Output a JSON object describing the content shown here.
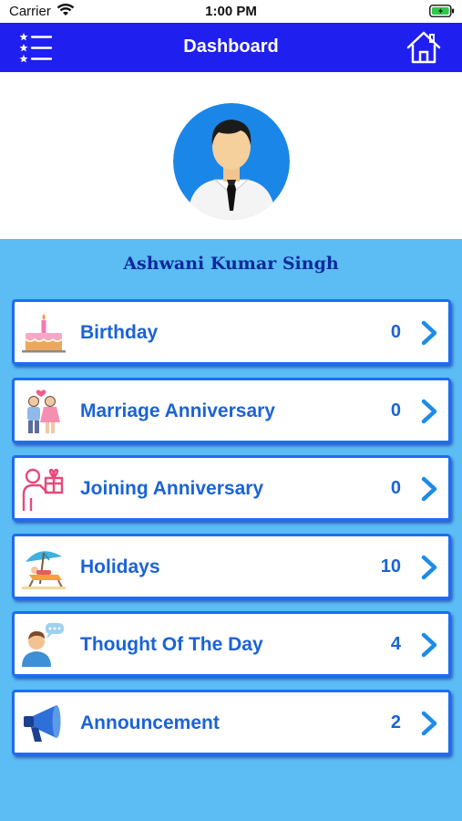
{
  "status_bar": {
    "carrier": "Carrier",
    "time": "1:00 PM"
  },
  "nav": {
    "title": "Dashboard",
    "menu_icon": "list-menu-icon",
    "home_icon": "home-icon"
  },
  "profile": {
    "name": "Ashwani Kumar Singh",
    "avatar_icon": "user-avatar-icon"
  },
  "colors": {
    "nav_bg": "#1f1ff0",
    "page_bg": "#5bbdf3",
    "card_border": "#1e6cf3",
    "label": "#1b63d6",
    "name": "#0b2a9c"
  },
  "menu": [
    {
      "label": "Birthday",
      "count": "0",
      "icon": "birthday-cake-icon"
    },
    {
      "label": "Marriage Anniversary",
      "count": "0",
      "icon": "couple-icon"
    },
    {
      "label": "Joining Anniversary",
      "count": "0",
      "icon": "gift-person-icon"
    },
    {
      "label": "Holidays",
      "count": "10",
      "icon": "beach-umbrella-icon"
    },
    {
      "label": "Thought Of The Day",
      "count": "4",
      "icon": "thinking-person-icon"
    },
    {
      "label": "Announcement",
      "count": "2",
      "icon": "megaphone-icon"
    }
  ]
}
